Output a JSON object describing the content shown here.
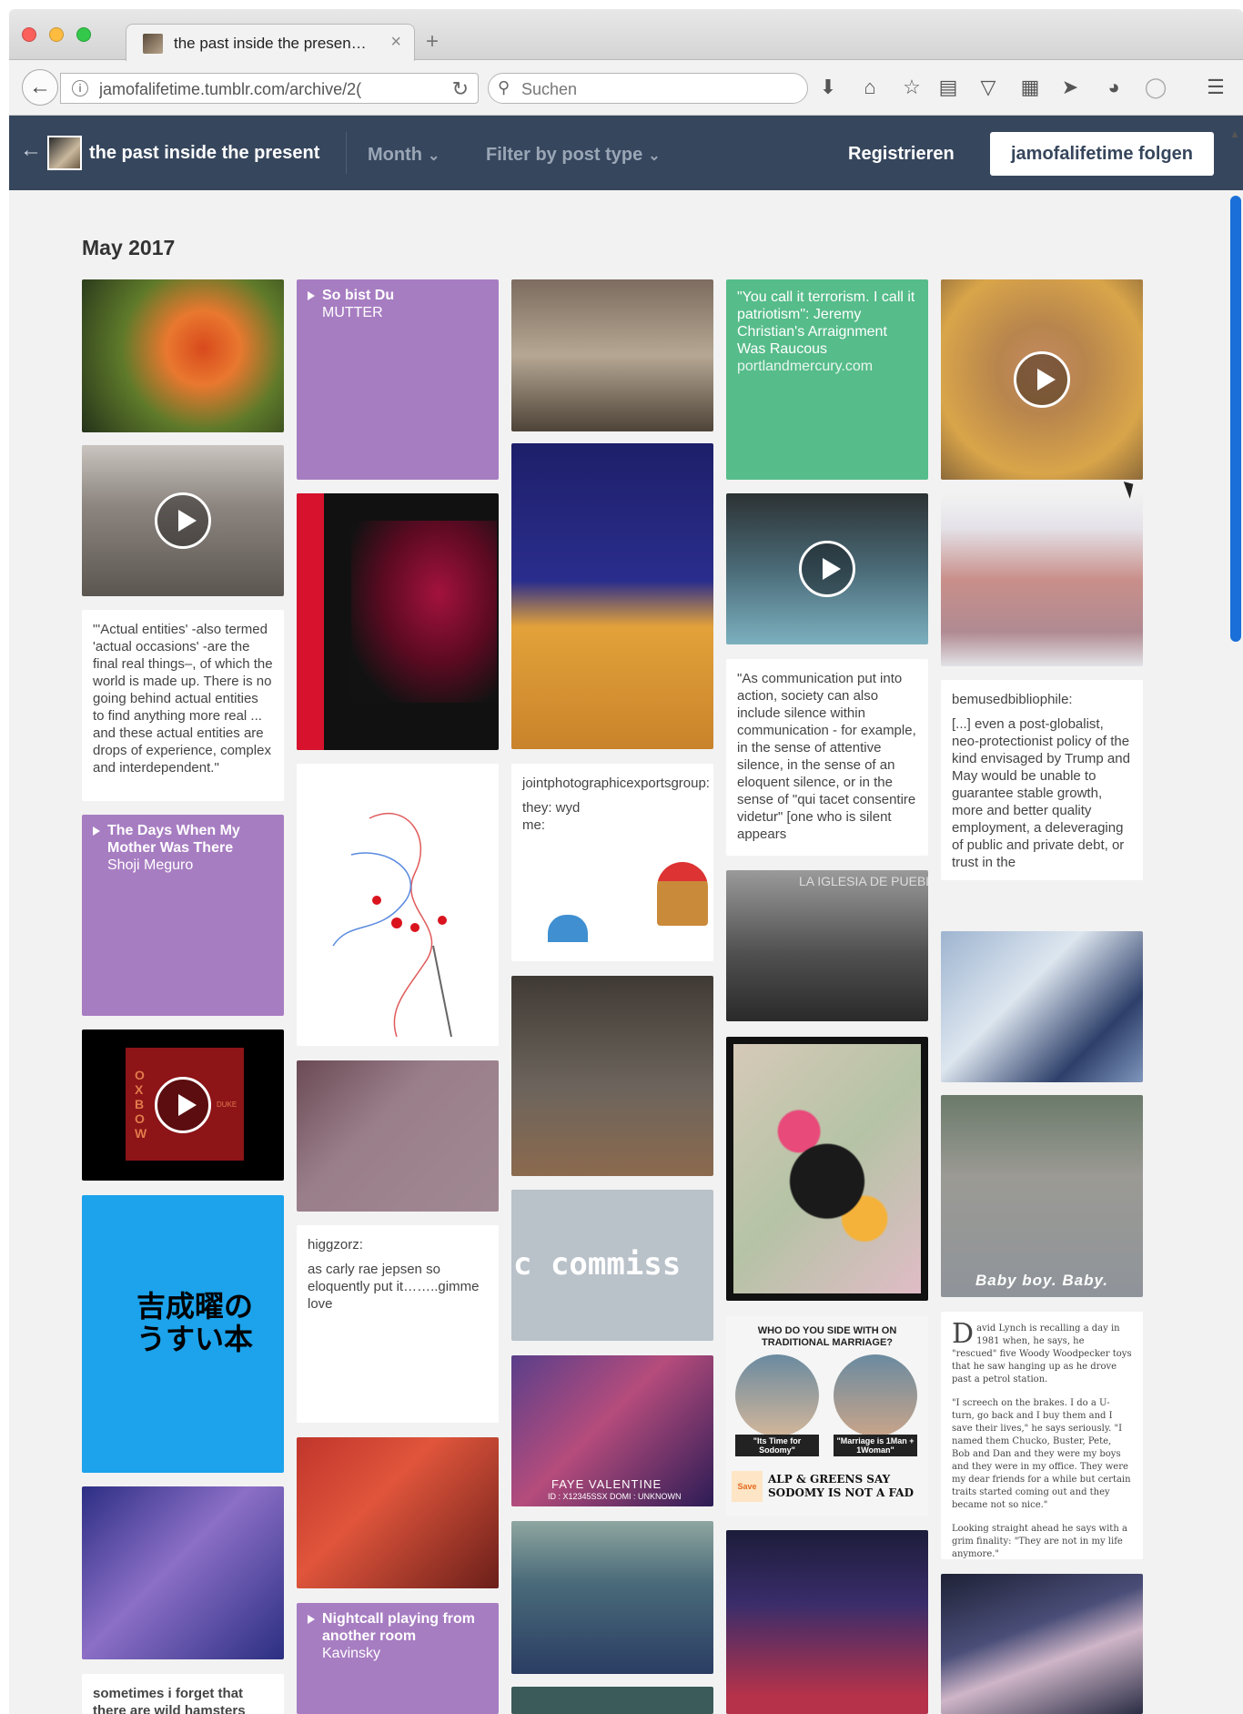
{
  "browser": {
    "tab_title": "the past inside the presen…",
    "tab_close": "×",
    "new_tab": "+",
    "url": "jamofalifetime.tumblr.com/archive/2(",
    "search_placeholder": "Suchen",
    "toolbar_icons": [
      "download-icon",
      "home-icon",
      "bookmark-star-icon",
      "reading-list-icon",
      "pocket-icon",
      "extension-icon",
      "send-icon",
      "history-icon",
      "chat-icon",
      "menu-icon"
    ]
  },
  "header": {
    "title": "the past inside the present",
    "month_label": "Month",
    "filter_label": "Filter by post type",
    "register_label": "Registrieren",
    "follow_label": "jamofalifetime folgen",
    "bg_color": "#36465d"
  },
  "archive": {
    "month_heading": "May 2017",
    "audio_posts": [
      {
        "title": "So bist Du",
        "artist": "MUTTER"
      },
      {
        "title": "The Days When My Mother Was There",
        "artist": "Shoji Meguro"
      },
      {
        "title": "Nightcall playing from another room",
        "artist": "Kavinsky"
      }
    ],
    "quote_whitehead": "\"'Actual entities' -also termed 'actual occasions' -are the final real things–, of which the world is made up. There is no going behind actual entities to find anything more real ... and these actual entities are drops of experience, complex and interdependent.\"",
    "link_post": {
      "title": "\"You call it terrorism. I call it patriotism\": Jeremy Christian's Arraignment Was Raucous",
      "source": "portlandmercury.com"
    },
    "chat_jpg": {
      "author": "jointphotographicexportsgroup:",
      "line1": "they: wyd",
      "line2": "me:"
    },
    "communication_quote": "\"As communication put into action, society can also include silence within communication - for example, in the sense of attentive silence, in the sense of an eloquent silence, or in the sense of \"qui tacet consentire videtur\" [one who is silent appears",
    "bemused": {
      "author": "bemusedbibliophile:",
      "text": "[...] even a post-globalist, neo-protectionist policy of the kind envisaged by Trump and May would be unable to guarantee stable growth, more and better quality employment, a deleveraging of public and private debt, or trust in the"
    },
    "higgzorz": {
      "author": "higgzorz:",
      "text": "as carly rae jepsen so eloquently put it……..gimme love"
    },
    "david_lynch_1": "avid Lynch is recalling a day in 1981 when, he says, he \"rescued\" five Woody Woodpecker toys that he saw hanging up as he drove past a petrol station.",
    "david_lynch_dropcap": "D",
    "david_lynch_2": "\"I screech on the brakes. I do a U-turn, go back and I buy them and I save their lives,\" he says seriously. \"I named them Chucko, Buster, Pete, Bob and Dan and they were my boys and they were in my office. They were my dear friends for a while but certain traits started coming out and they became not so nice.\"",
    "david_lynch_3": "Looking straight ahead he says with a grim finality: \"They are not in my life anymore.\"",
    "hamsters": "sometimes i forget that there are wild hamsters",
    "oxbow_letters": "OXBOW",
    "oxbow_side": "DUKE",
    "japanese_text": "吉成曜の うすい本",
    "commission_text": "c commiss",
    "faye_text": "FAYE VALENTINE",
    "faye_id": "ID : X12345SSX  DOMI : UNKNOWN",
    "marriage": {
      "headline": "WHO DO YOU SIDE WITH ON TRADITIONAL MARRIAGE?",
      "left_caption": "\"Its Time for Sodomy\"",
      "right_caption": "\"Marriage is 1Man + 1Woman\"",
      "bottom": "ALP & GREENS SAY SODOMY IS NOT A FAD",
      "badge": "Save"
    },
    "harrison_caption": "Baby boy. Baby.",
    "church_sign": "LA IGLESIA DE PUEBLO",
    "colors": {
      "audio": "#a77dc2",
      "link": "#56bc8a",
      "background": "#f2f2f2"
    }
  }
}
